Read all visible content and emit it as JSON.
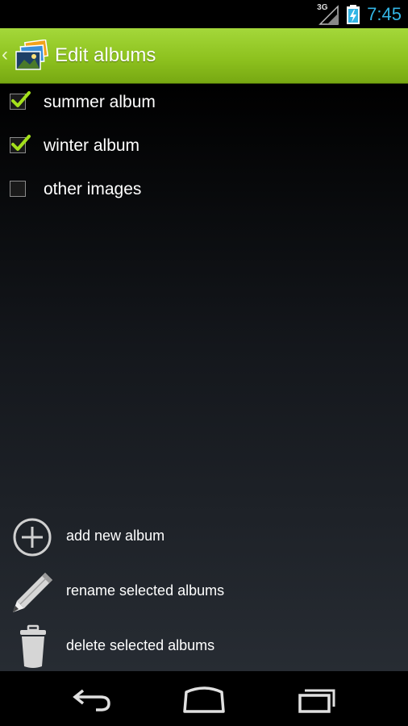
{
  "status_bar": {
    "network": "3G",
    "time": "7:45",
    "time_color": "#33b5e5",
    "icons": [
      "signal-icon",
      "battery-charging-icon"
    ]
  },
  "action_bar": {
    "title": "Edit albums",
    "icon": "gallery-app-icon",
    "up_icon": "up-caret-icon",
    "color": "#8ec21f"
  },
  "albums": [
    {
      "label": "summer album",
      "checked": true
    },
    {
      "label": "winter album",
      "checked": true
    },
    {
      "label": "other images",
      "checked": false
    }
  ],
  "actions": [
    {
      "label": "add new album",
      "icon": "add-circle-icon"
    },
    {
      "label": "rename selected albums",
      "icon": "pencil-icon"
    },
    {
      "label": "delete selected albums",
      "icon": "trash-icon"
    }
  ],
  "nav_bar": {
    "icons": [
      "back-icon",
      "home-icon",
      "recent-apps-icon"
    ]
  },
  "colors": {
    "check_accent": "#a4e01c",
    "text": "#ffffff"
  }
}
